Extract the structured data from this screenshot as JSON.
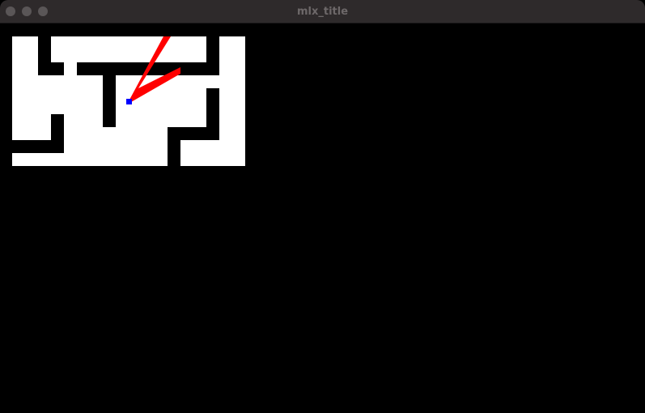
{
  "window": {
    "title": "mlx_title",
    "traffic_light_color": "#5a5657",
    "titlebar_color": "#2e2a2b",
    "title_color": "#6d6869"
  },
  "game": {
    "floor_color": "#ffffff",
    "wall_color": "#000000",
    "ray_color": "#ff0000",
    "player_color": "#0000ff"
  }
}
